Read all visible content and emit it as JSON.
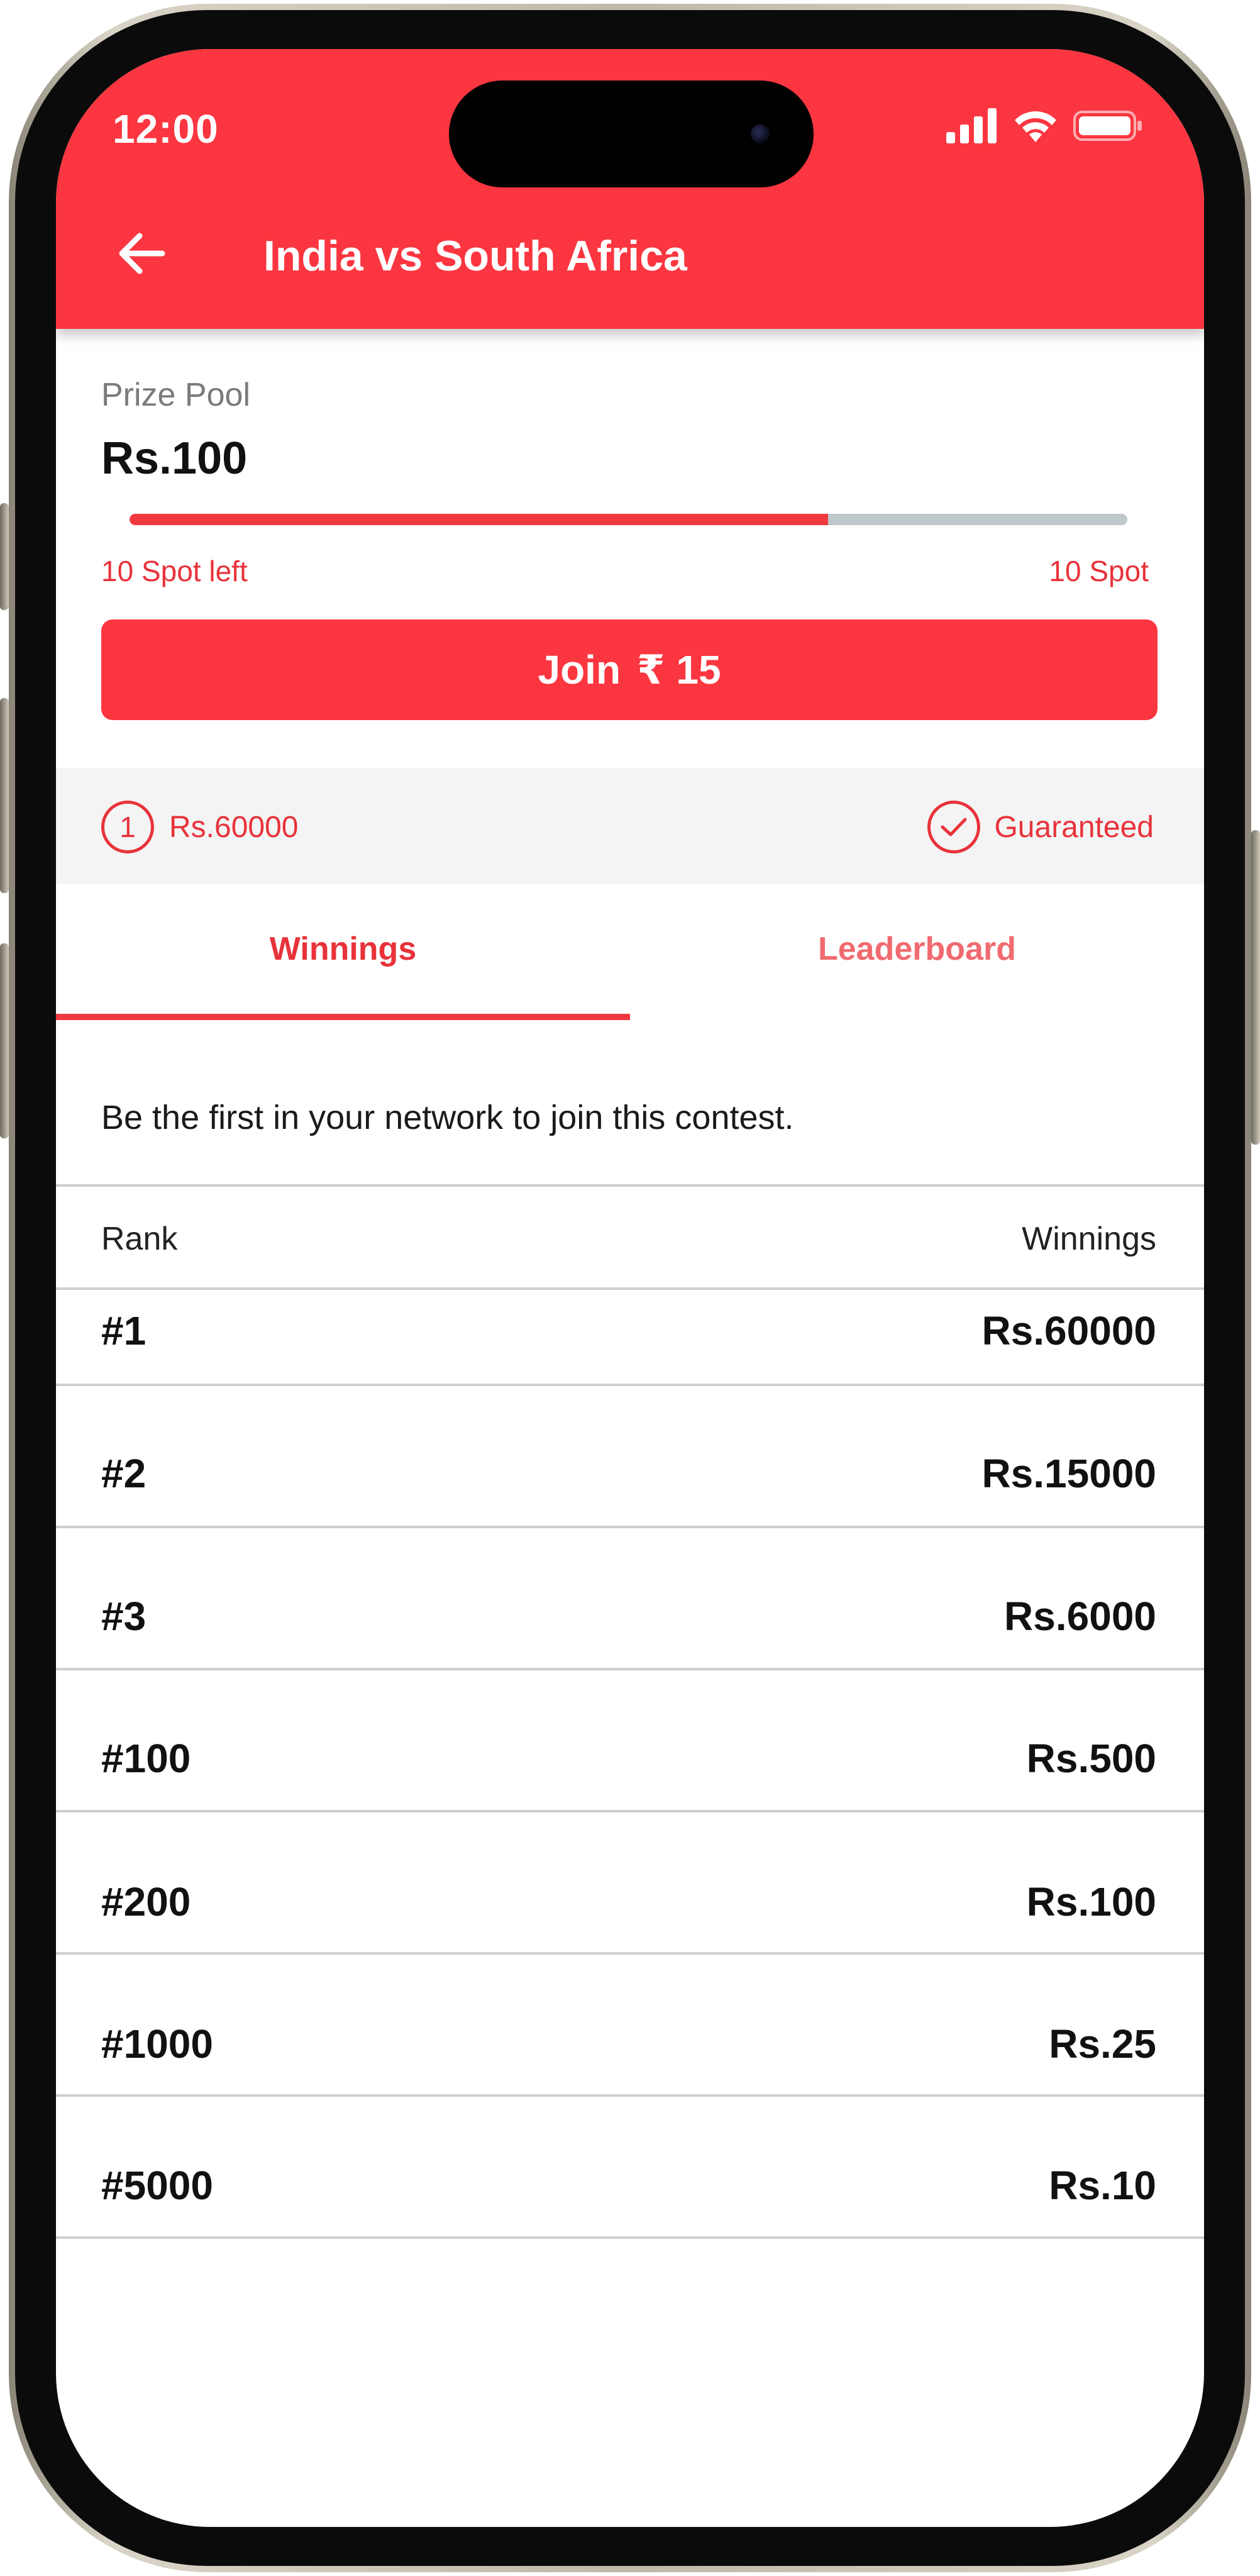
{
  "status_bar": {
    "time": "12:00",
    "icons": [
      "signal-icon",
      "wifi-icon",
      "battery-icon"
    ]
  },
  "header": {
    "back_icon": "arrow-left-icon",
    "title": "India vs South Africa"
  },
  "prize": {
    "label": "Prize Pool",
    "amount": "Rs.100",
    "progress_fraction": 0.7,
    "spots_left": "10 Spot left",
    "spots_total": "10 Spot"
  },
  "join": {
    "label": "Join",
    "currency": "₹",
    "price": "15"
  },
  "info": {
    "rank_number": "1",
    "first_prize": "Rs.60000",
    "guaranteed": "Guaranteed"
  },
  "tabs": [
    {
      "label": "Winnings",
      "active": true
    },
    {
      "label": "Leaderboard",
      "active": false
    }
  ],
  "network_message": "Be the first in your network to join this contest.",
  "table": {
    "headers": {
      "rank": "Rank",
      "winnings": "Winnings"
    },
    "rows": [
      {
        "rank": "#1",
        "amount": "Rs.60000"
      },
      {
        "rank": "#2",
        "amount": "Rs.15000"
      },
      {
        "rank": "#3",
        "amount": "Rs.6000"
      },
      {
        "rank": "#100",
        "amount": "Rs.500"
      },
      {
        "rank": "#200",
        "amount": "Rs.100"
      },
      {
        "rank": "#1000",
        "amount": "Rs.25"
      },
      {
        "rank": "#5000",
        "amount": "Rs.10"
      }
    ]
  },
  "colors": {
    "primary_red": "#fb3640",
    "accent_red": "#e8323a",
    "progress_track": "#bec7c9",
    "strip_bg": "#f4f4f4"
  }
}
